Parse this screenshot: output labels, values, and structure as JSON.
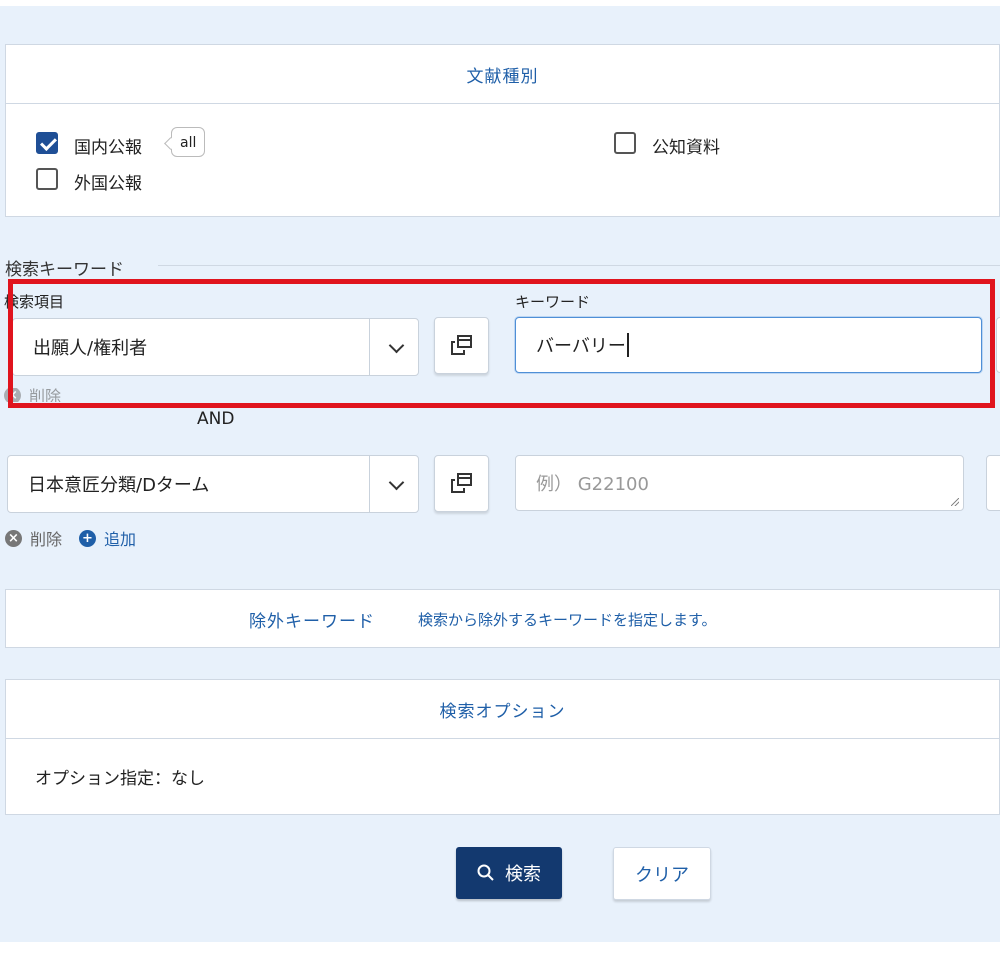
{
  "doc_type": {
    "title": "文献種別",
    "options": [
      {
        "label": "国内公報",
        "checked": true
      },
      {
        "label": "外国公報",
        "checked": false
      },
      {
        "label": "公知資料",
        "checked": false
      }
    ],
    "all_badge": "all"
  },
  "search_keyword": {
    "title": "検索キーワード",
    "field_label": "検索項目",
    "keyword_label": "キーワード",
    "rows": [
      {
        "field": "出願人/権利者",
        "value": "バーバリー",
        "placeholder": ""
      },
      {
        "field": "日本意匠分類/Dターム",
        "value": "",
        "placeholder": "例） G22100"
      }
    ],
    "operator": "AND",
    "hidden_delete_label": "削除",
    "delete_label": "削除",
    "add_label": "追加"
  },
  "exclude": {
    "title": "除外キーワード",
    "description": "検索から除外するキーワードを指定します。"
  },
  "options": {
    "title": "検索オプション",
    "summary": "オプション指定：なし"
  },
  "buttons": {
    "search": "検索",
    "clear": "クリア"
  },
  "colors": {
    "accent": "#1f5fa8",
    "primary_button": "#13396f",
    "highlight": "#e0141e",
    "background": "#e8f1fb"
  },
  "icons": [
    "check-icon",
    "popup-window-icon",
    "chevron-down-icon",
    "remove-circle-icon",
    "add-circle-icon",
    "search-icon"
  ]
}
